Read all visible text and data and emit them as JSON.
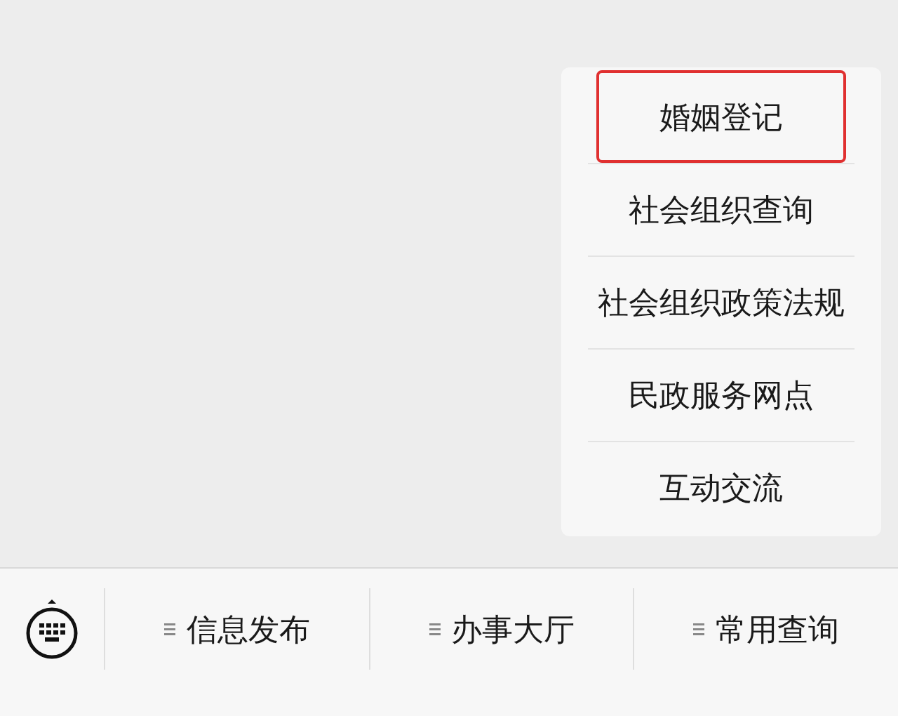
{
  "submenu": {
    "items": [
      {
        "label": "婚姻登记",
        "highlighted": true
      },
      {
        "label": "社会组织查询",
        "highlighted": false
      },
      {
        "label": "社会组织政策法规",
        "highlighted": false
      },
      {
        "label": "民政服务网点",
        "highlighted": false
      },
      {
        "label": "互动交流",
        "highlighted": false
      }
    ]
  },
  "menu_bar": {
    "items": [
      {
        "label": "信息发布"
      },
      {
        "label": "办事大厅"
      },
      {
        "label": "常用查询"
      }
    ]
  }
}
